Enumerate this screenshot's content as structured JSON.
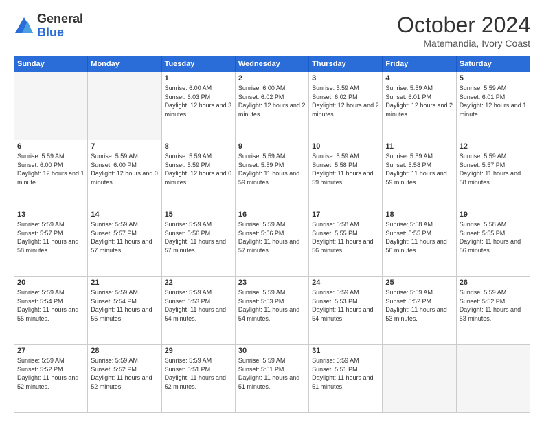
{
  "logo": {
    "general": "General",
    "blue": "Blue"
  },
  "title": "October 2024",
  "location": "Matemandia, Ivory Coast",
  "headers": [
    "Sunday",
    "Monday",
    "Tuesday",
    "Wednesday",
    "Thursday",
    "Friday",
    "Saturday"
  ],
  "days": [
    {
      "num": "",
      "sunrise": "",
      "sunset": "",
      "daylight": "",
      "empty": true
    },
    {
      "num": "",
      "sunrise": "",
      "sunset": "",
      "daylight": "",
      "empty": true
    },
    {
      "num": "1",
      "sunrise": "Sunrise: 6:00 AM",
      "sunset": "Sunset: 6:03 PM",
      "daylight": "Daylight: 12 hours and 3 minutes."
    },
    {
      "num": "2",
      "sunrise": "Sunrise: 6:00 AM",
      "sunset": "Sunset: 6:02 PM",
      "daylight": "Daylight: 12 hours and 2 minutes."
    },
    {
      "num": "3",
      "sunrise": "Sunrise: 5:59 AM",
      "sunset": "Sunset: 6:02 PM",
      "daylight": "Daylight: 12 hours and 2 minutes."
    },
    {
      "num": "4",
      "sunrise": "Sunrise: 5:59 AM",
      "sunset": "Sunset: 6:01 PM",
      "daylight": "Daylight: 12 hours and 2 minutes."
    },
    {
      "num": "5",
      "sunrise": "Sunrise: 5:59 AM",
      "sunset": "Sunset: 6:01 PM",
      "daylight": "Daylight: 12 hours and 1 minute."
    },
    {
      "num": "6",
      "sunrise": "Sunrise: 5:59 AM",
      "sunset": "Sunset: 6:00 PM",
      "daylight": "Daylight: 12 hours and 1 minute."
    },
    {
      "num": "7",
      "sunrise": "Sunrise: 5:59 AM",
      "sunset": "Sunset: 6:00 PM",
      "daylight": "Daylight: 12 hours and 0 minutes."
    },
    {
      "num": "8",
      "sunrise": "Sunrise: 5:59 AM",
      "sunset": "Sunset: 5:59 PM",
      "daylight": "Daylight: 12 hours and 0 minutes."
    },
    {
      "num": "9",
      "sunrise": "Sunrise: 5:59 AM",
      "sunset": "Sunset: 5:59 PM",
      "daylight": "Daylight: 11 hours and 59 minutes."
    },
    {
      "num": "10",
      "sunrise": "Sunrise: 5:59 AM",
      "sunset": "Sunset: 5:58 PM",
      "daylight": "Daylight: 11 hours and 59 minutes."
    },
    {
      "num": "11",
      "sunrise": "Sunrise: 5:59 AM",
      "sunset": "Sunset: 5:58 PM",
      "daylight": "Daylight: 11 hours and 59 minutes."
    },
    {
      "num": "12",
      "sunrise": "Sunrise: 5:59 AM",
      "sunset": "Sunset: 5:57 PM",
      "daylight": "Daylight: 11 hours and 58 minutes."
    },
    {
      "num": "13",
      "sunrise": "Sunrise: 5:59 AM",
      "sunset": "Sunset: 5:57 PM",
      "daylight": "Daylight: 11 hours and 58 minutes."
    },
    {
      "num": "14",
      "sunrise": "Sunrise: 5:59 AM",
      "sunset": "Sunset: 5:57 PM",
      "daylight": "Daylight: 11 hours and 57 minutes."
    },
    {
      "num": "15",
      "sunrise": "Sunrise: 5:59 AM",
      "sunset": "Sunset: 5:56 PM",
      "daylight": "Daylight: 11 hours and 57 minutes."
    },
    {
      "num": "16",
      "sunrise": "Sunrise: 5:59 AM",
      "sunset": "Sunset: 5:56 PM",
      "daylight": "Daylight: 11 hours and 57 minutes."
    },
    {
      "num": "17",
      "sunrise": "Sunrise: 5:58 AM",
      "sunset": "Sunset: 5:55 PM",
      "daylight": "Daylight: 11 hours and 56 minutes."
    },
    {
      "num": "18",
      "sunrise": "Sunrise: 5:58 AM",
      "sunset": "Sunset: 5:55 PM",
      "daylight": "Daylight: 11 hours and 56 minutes."
    },
    {
      "num": "19",
      "sunrise": "Sunrise: 5:58 AM",
      "sunset": "Sunset: 5:55 PM",
      "daylight": "Daylight: 11 hours and 56 minutes."
    },
    {
      "num": "20",
      "sunrise": "Sunrise: 5:59 AM",
      "sunset": "Sunset: 5:54 PM",
      "daylight": "Daylight: 11 hours and 55 minutes."
    },
    {
      "num": "21",
      "sunrise": "Sunrise: 5:59 AM",
      "sunset": "Sunset: 5:54 PM",
      "daylight": "Daylight: 11 hours and 55 minutes."
    },
    {
      "num": "22",
      "sunrise": "Sunrise: 5:59 AM",
      "sunset": "Sunset: 5:53 PM",
      "daylight": "Daylight: 11 hours and 54 minutes."
    },
    {
      "num": "23",
      "sunrise": "Sunrise: 5:59 AM",
      "sunset": "Sunset: 5:53 PM",
      "daylight": "Daylight: 11 hours and 54 minutes."
    },
    {
      "num": "24",
      "sunrise": "Sunrise: 5:59 AM",
      "sunset": "Sunset: 5:53 PM",
      "daylight": "Daylight: 11 hours and 54 minutes."
    },
    {
      "num": "25",
      "sunrise": "Sunrise: 5:59 AM",
      "sunset": "Sunset: 5:52 PM",
      "daylight": "Daylight: 11 hours and 53 minutes."
    },
    {
      "num": "26",
      "sunrise": "Sunrise: 5:59 AM",
      "sunset": "Sunset: 5:52 PM",
      "daylight": "Daylight: 11 hours and 53 minutes."
    },
    {
      "num": "27",
      "sunrise": "Sunrise: 5:59 AM",
      "sunset": "Sunset: 5:52 PM",
      "daylight": "Daylight: 11 hours and 52 minutes."
    },
    {
      "num": "28",
      "sunrise": "Sunrise: 5:59 AM",
      "sunset": "Sunset: 5:52 PM",
      "daylight": "Daylight: 11 hours and 52 minutes."
    },
    {
      "num": "29",
      "sunrise": "Sunrise: 5:59 AM",
      "sunset": "Sunset: 5:51 PM",
      "daylight": "Daylight: 11 hours and 52 minutes."
    },
    {
      "num": "30",
      "sunrise": "Sunrise: 5:59 AM",
      "sunset": "Sunset: 5:51 PM",
      "daylight": "Daylight: 11 hours and 51 minutes."
    },
    {
      "num": "31",
      "sunrise": "Sunrise: 5:59 AM",
      "sunset": "Sunset: 5:51 PM",
      "daylight": "Daylight: 11 hours and 51 minutes."
    },
    {
      "num": "",
      "sunrise": "",
      "sunset": "",
      "daylight": "",
      "empty": true
    },
    {
      "num": "",
      "sunrise": "",
      "sunset": "",
      "daylight": "",
      "empty": true
    }
  ]
}
